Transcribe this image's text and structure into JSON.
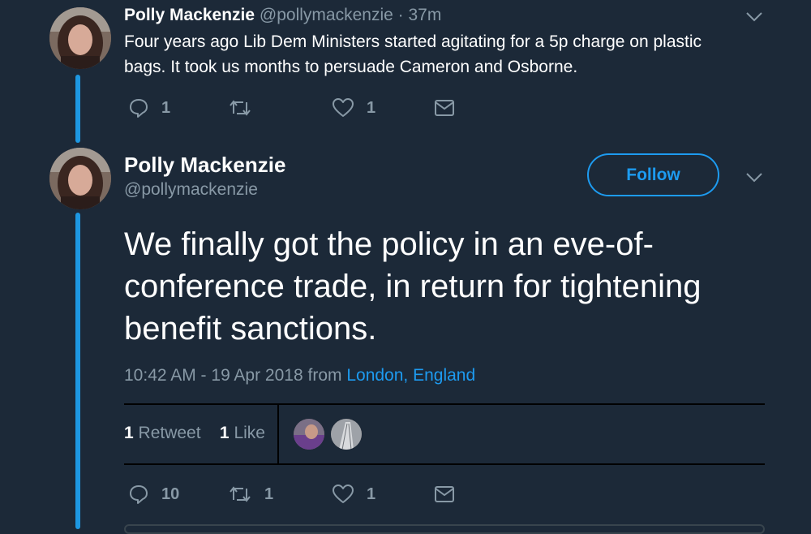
{
  "tweet1": {
    "name": "Polly Mackenzie",
    "handle": "@pollymackenzie",
    "time": "· 37m",
    "text_line1": "Four years ago Lib Dem Ministers started agitating for a 5p charge on plastic",
    "text_line2": "bags. It took us months to persuade Cameron and Osborne.",
    "replies": "1",
    "retweets": "",
    "likes": "1"
  },
  "tweet2": {
    "name": "Polly Mackenzie",
    "handle": "@pollymackenzie",
    "follow_label": "Follow",
    "text_line1": "We finally got the policy in an eve-of-",
    "text_line2": "conference trade, in return for tightening",
    "text_line3": "benefit sanctions.",
    "timestamp": "10:42 AM - 19 Apr 2018 from",
    "location": "London, England",
    "retweet_count": "1",
    "retweet_label": "Retweet",
    "like_count": "1",
    "like_label": "Like",
    "replies": "10",
    "retweets": "1",
    "likes": "1"
  },
  "icons": {
    "reply": "reply-icon",
    "retweet": "retweet-icon",
    "like": "heart-icon",
    "dm": "mail-icon",
    "menu": "chevron-down-icon"
  },
  "colors": {
    "background": "#1c2938",
    "accent": "#1d9bf0",
    "muted": "#8899a6",
    "thread_line": "#1d97e1"
  }
}
